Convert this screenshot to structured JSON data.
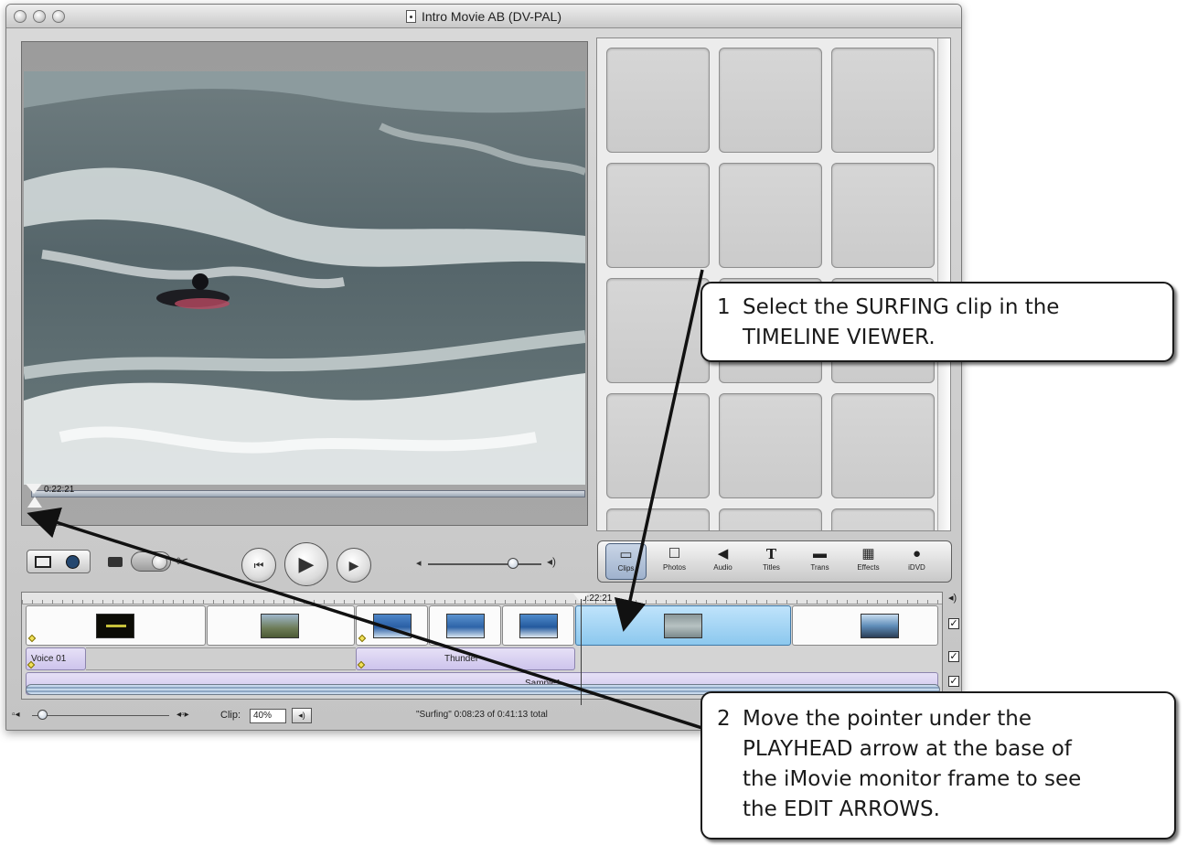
{
  "window": {
    "title": "Intro Movie AB (DV-PAL)"
  },
  "monitor": {
    "timecode": "0:22:21"
  },
  "pane_buttons": [
    {
      "label": "Clips",
      "icon": "clips-icon",
      "glyph": "▭"
    },
    {
      "label": "Photos",
      "icon": "photos-icon",
      "glyph": "☐"
    },
    {
      "label": "Audio",
      "icon": "audio-icon",
      "glyph": "◀"
    },
    {
      "label": "Titles",
      "icon": "titles-icon",
      "glyph": "T"
    },
    {
      "label": "Trans",
      "icon": "transitions-icon",
      "glyph": "▬"
    },
    {
      "label": "Effects",
      "icon": "effects-icon",
      "glyph": "▦"
    },
    {
      "label": "iDVD",
      "icon": "idvd-icon",
      "glyph": "●"
    }
  ],
  "timeline": {
    "playhead_timecode": "0:22:21",
    "audio_track1": {
      "clip1": "Voice 01",
      "clip2": "Thunder"
    },
    "audio_track2": {
      "clip1": "Sample1"
    }
  },
  "status": {
    "clip_label": "Clip:",
    "clip_volume": "40%",
    "info": "\"Surfing\"  0:08:23 of 0:41:13 total"
  },
  "callouts": {
    "one": {
      "number": "1",
      "text": "Select the SURFING clip in the\nTIMELINE VIEWER."
    },
    "two": {
      "number": "2",
      "text": "Move the pointer under the\nPLAYHEAD arrow at the base of\nthe iMovie monitor frame to see\nthe EDIT ARROWS."
    }
  },
  "colors": {
    "selected_clip": "#8cc8ee",
    "audio_clip": "#cdc4ec",
    "callout_border": "#1a1a1a"
  }
}
